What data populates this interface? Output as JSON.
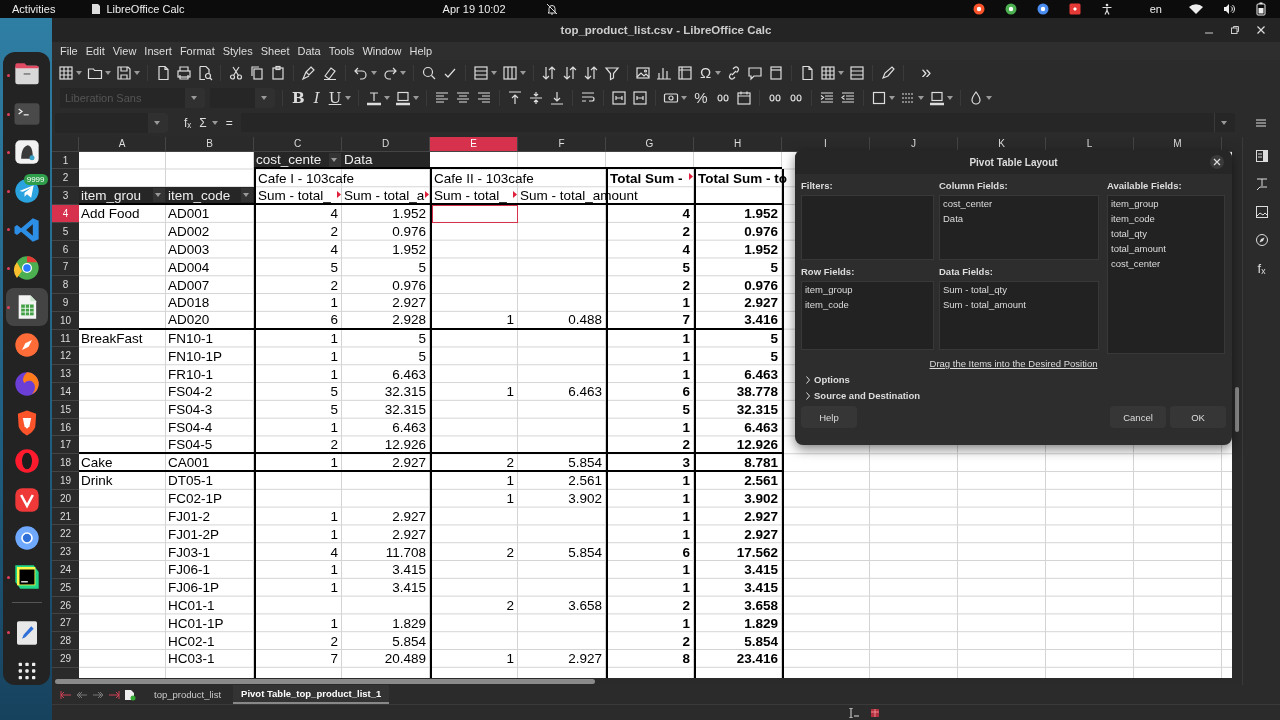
{
  "top_bar": {
    "activities": "Activities",
    "app_name": "LibreOffice Calc",
    "clock": "Apr 19 10:02",
    "keyboard_layout": "en"
  },
  "dock": [
    {
      "running": true,
      "selected": false
    },
    {
      "running": true,
      "selected": false
    },
    {
      "running": true,
      "selected": false
    },
    {
      "running": true,
      "selected": false,
      "badge": "9999"
    },
    {
      "running": true,
      "selected": false
    },
    {
      "running": true,
      "selected": false
    },
    {
      "running": true,
      "selected": true
    },
    {
      "running": false,
      "selected": false
    },
    {
      "running": false,
      "selected": false
    },
    {
      "running": false,
      "selected": false
    },
    {
      "running": false,
      "selected": false
    },
    {
      "running": false,
      "selected": false
    },
    {
      "running": false,
      "selected": false
    },
    {
      "running": true,
      "selected": false
    },
    {
      "running": true,
      "selected": false
    }
  ],
  "window": {
    "title": "top_product_list.csv - LibreOffice Calc"
  },
  "menu": [
    "File",
    "Edit",
    "View",
    "Insert",
    "Format",
    "Styles",
    "Sheet",
    "Data",
    "Tools",
    "Window",
    "Help"
  ],
  "toolbar_glyphs": {
    "special_character": "Ω",
    "more": "»",
    "bold": "B",
    "italic": "I",
    "underline": "U",
    "percent": "%"
  },
  "font_name": {
    "placeholder": "Liberation Sans",
    "disabled": true
  },
  "formula_bar": {
    "function_wizard": "fₓ",
    "sum": "Σ",
    "formula": "="
  },
  "sidebar": {
    "functions_glyph": "fₓ"
  },
  "sheet": {
    "columns": [
      {
        "label": "A",
        "selected": false,
        "kind": "row-field"
      },
      {
        "label": "B",
        "selected": false,
        "kind": "row-field"
      },
      {
        "label": "C",
        "selected": false,
        "kind": "data"
      },
      {
        "label": "D",
        "selected": false,
        "kind": "data"
      },
      {
        "label": "E",
        "selected": true,
        "kind": "data"
      },
      {
        "label": "F",
        "selected": false,
        "kind": "data"
      },
      {
        "label": "G",
        "selected": false,
        "kind": "total"
      },
      {
        "label": "H",
        "selected": false,
        "kind": "total"
      },
      {
        "label": "I",
        "selected": false,
        "kind": "empty"
      },
      {
        "label": "J",
        "selected": false,
        "kind": "empty"
      },
      {
        "label": "K",
        "selected": false,
        "kind": "empty"
      },
      {
        "label": "L",
        "selected": false,
        "kind": "empty"
      },
      {
        "label": "M",
        "selected": false,
        "kind": "empty"
      }
    ],
    "rows": [
      {
        "number": "1",
        "selected": false,
        "kind": "header",
        "cells": {
          "C": {
            "text": "cost_cente",
            "kind": "field-button"
          },
          "D": {
            "text": "Data",
            "kind": "field-label"
          }
        }
      },
      {
        "number": "2",
        "selected": false,
        "kind": "header",
        "cells": {
          "C": {
            "text": "Cafe I - 103cafe",
            "kind": "text"
          },
          "E": {
            "text": "Cafe II - 103cafe",
            "kind": "text"
          },
          "G": {
            "text": "Total Sum - ",
            "kind": "total",
            "cut": true
          },
          "H": {
            "text": "Total Sum - to",
            "kind": "total"
          }
        }
      },
      {
        "number": "3",
        "selected": false,
        "kind": "header",
        "cells": {
          "A": {
            "text": "item_grou",
            "kind": "field-button"
          },
          "B": {
            "text": "item_code",
            "kind": "field-button"
          },
          "C": {
            "text": "Sum - total_",
            "kind": "text",
            "cut": true
          },
          "D": {
            "text": "Sum - total_a",
            "kind": "text",
            "cut": true
          },
          "E": {
            "text": "Sum - total_",
            "kind": "text",
            "cut": true
          },
          "F": {
            "text": "Sum - total_amount",
            "kind": "text"
          }
        }
      },
      {
        "number": "4",
        "selected": true,
        "kind": "data",
        "cells": {
          "A": "Add Food",
          "B": "AD001",
          "C": "4",
          "D": "1.952",
          "G": "4",
          "H": "1.952"
        }
      },
      {
        "number": "5",
        "selected": false,
        "kind": "data",
        "cells": {
          "B": "AD002",
          "C": "2",
          "D": "0.976",
          "G": "2",
          "H": "0.976"
        }
      },
      {
        "number": "6",
        "selected": false,
        "kind": "data",
        "cells": {
          "B": "AD003",
          "C": "4",
          "D": "1.952",
          "G": "4",
          "H": "1.952"
        }
      },
      {
        "number": "7",
        "selected": false,
        "kind": "data",
        "cells": {
          "B": "AD004",
          "C": "5",
          "D": "5",
          "G": "5",
          "H": "5"
        }
      },
      {
        "number": "8",
        "selected": false,
        "kind": "data",
        "cells": {
          "B": "AD007",
          "C": "2",
          "D": "0.976",
          "G": "2",
          "H": "0.976"
        }
      },
      {
        "number": "9",
        "selected": false,
        "kind": "data",
        "cells": {
          "B": "AD018",
          "C": "1",
          "D": "2.927",
          "G": "1",
          "H": "2.927"
        }
      },
      {
        "number": "10",
        "selected": false,
        "kind": "data",
        "cells": {
          "B": "AD020",
          "C": "6",
          "D": "2.928",
          "E": "1",
          "F": "0.488",
          "G": "7",
          "H": "3.416"
        }
      },
      {
        "number": "11",
        "selected": false,
        "kind": "data",
        "cells": {
          "A": "BreakFast",
          "B": "FN10-1",
          "C": "1",
          "D": "5",
          "G": "1",
          "H": "5"
        }
      },
      {
        "number": "12",
        "selected": false,
        "kind": "data",
        "cells": {
          "B": "FN10-1P",
          "C": "1",
          "D": "5",
          "G": "1",
          "H": "5"
        }
      },
      {
        "number": "13",
        "selected": false,
        "kind": "data",
        "cells": {
          "B": "FR10-1",
          "C": "1",
          "D": "6.463",
          "G": "1",
          "H": "6.463"
        }
      },
      {
        "number": "14",
        "selected": false,
        "kind": "data",
        "cells": {
          "B": "FS04-2",
          "C": "5",
          "D": "32.315",
          "E": "1",
          "F": "6.463",
          "G": "6",
          "H": "38.778"
        }
      },
      {
        "number": "15",
        "selected": false,
        "kind": "data",
        "cells": {
          "B": "FS04-3",
          "C": "5",
          "D": "32.315",
          "G": "5",
          "H": "32.315"
        }
      },
      {
        "number": "16",
        "selected": false,
        "kind": "data",
        "cells": {
          "B": "FS04-4",
          "C": "1",
          "D": "6.463",
          "G": "1",
          "H": "6.463"
        }
      },
      {
        "number": "17",
        "selected": false,
        "kind": "data",
        "cells": {
          "B": "FS04-5",
          "C": "2",
          "D": "12.926",
          "G": "2",
          "H": "12.926"
        }
      },
      {
        "number": "18",
        "selected": false,
        "kind": "data",
        "cells": {
          "A": "Cake",
          "B": "CA001",
          "C": "1",
          "D": "2.927",
          "E": "2",
          "F": "5.854",
          "G": "3",
          "H": "8.781"
        }
      },
      {
        "number": "19",
        "selected": false,
        "kind": "data",
        "cells": {
          "A": "Drink",
          "B": "DT05-1",
          "E": "1",
          "F": "2.561",
          "G": "1",
          "H": "2.561"
        }
      },
      {
        "number": "20",
        "selected": false,
        "kind": "data",
        "cells": {
          "B": "FC02-1P",
          "E": "1",
          "F": "3.902",
          "G": "1",
          "H": "3.902"
        }
      },
      {
        "number": "21",
        "selected": false,
        "kind": "data",
        "cells": {
          "B": "FJ01-2",
          "C": "1",
          "D": "2.927",
          "G": "1",
          "H": "2.927"
        }
      },
      {
        "number": "22",
        "selected": false,
        "kind": "data",
        "cells": {
          "B": "FJ01-2P",
          "C": "1",
          "D": "2.927",
          "G": "1",
          "H": "2.927"
        }
      },
      {
        "number": "23",
        "selected": false,
        "kind": "data",
        "cells": {
          "B": "FJ03-1",
          "C": "4",
          "D": "11.708",
          "E": "2",
          "F": "5.854",
          "G": "6",
          "H": "17.562"
        }
      },
      {
        "number": "24",
        "selected": false,
        "kind": "data",
        "cells": {
          "B": "FJ06-1",
          "C": "1",
          "D": "3.415",
          "G": "1",
          "H": "3.415"
        }
      },
      {
        "number": "25",
        "selected": false,
        "kind": "data",
        "cells": {
          "B": "FJ06-1P",
          "C": "1",
          "D": "3.415",
          "G": "1",
          "H": "3.415"
        }
      },
      {
        "number": "26",
        "selected": false,
        "kind": "data",
        "cells": {
          "B": "HC01-1",
          "E": "2",
          "F": "3.658",
          "G": "2",
          "H": "3.658"
        }
      },
      {
        "number": "27",
        "selected": false,
        "kind": "data",
        "cells": {
          "B": "HC01-1P",
          "C": "1",
          "D": "1.829",
          "G": "1",
          "H": "1.829"
        }
      },
      {
        "number": "28",
        "selected": false,
        "kind": "data",
        "cells": {
          "B": "HC02-1",
          "C": "2",
          "D": "5.854",
          "G": "2",
          "H": "5.854"
        }
      },
      {
        "number": "29",
        "selected": false,
        "kind": "data",
        "cells": {
          "B": "HC03-1",
          "C": "7",
          "D": "20.489",
          "E": "1",
          "F": "2.927",
          "G": "8",
          "H": "23.416"
        }
      }
    ]
  },
  "sheet_tabs": [
    {
      "label": "top_product_list",
      "selected": false
    },
    {
      "label": "Pivot Table_top_product_list_1",
      "selected": true
    }
  ],
  "dialog": {
    "title": "Pivot Table Layout",
    "filters": {
      "label": "Filters:"
    },
    "column_fields": {
      "label": "Column Fields:",
      "items": [
        "cost_center",
        "Data"
      ]
    },
    "available_fields": {
      "label": "Available Fields:",
      "items": [
        "item_group",
        "item_code",
        "total_qty",
        "total_amount",
        "cost_center"
      ]
    },
    "row_fields": {
      "label": "Row Fields:",
      "items": [
        "item_group",
        "item_code"
      ]
    },
    "data_fields": {
      "label": "Data Fields:",
      "items": [
        "Sum - total_qty",
        "Sum - total_amount"
      ]
    },
    "hint": "Drag the Items into the Desired Position",
    "expanders": [
      {
        "label": "Options",
        "expanded": false
      },
      {
        "label": "Source and Destination",
        "expanded": false
      }
    ],
    "buttons": [
      {
        "label": "Help",
        "kind": "help"
      },
      {
        "label": "Cancel",
        "kind": "cancel"
      },
      {
        "label": "OK",
        "kind": "ok"
      }
    ]
  }
}
